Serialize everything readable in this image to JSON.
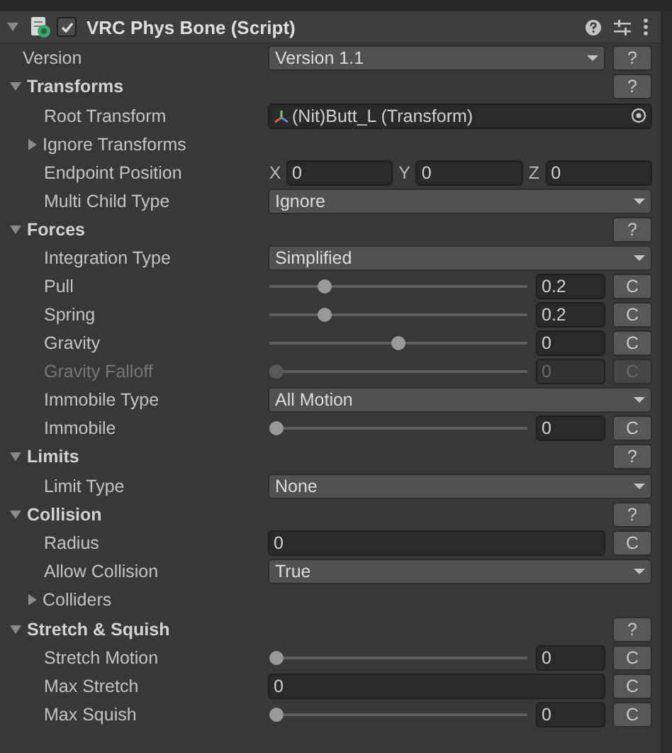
{
  "component": {
    "title": "VRC Phys Bone (Script)",
    "expanded": true,
    "enabled": true
  },
  "rows": [
    {
      "kind": "dropdown",
      "label": "Version",
      "value": "Version 1.1",
      "button": "?"
    },
    {
      "kind": "section",
      "label": "Transforms",
      "expanded": true,
      "button": "?",
      "children": [
        {
          "kind": "object",
          "label": "Root Transform",
          "value": "(Nit)Butt_L (Transform)"
        },
        {
          "kind": "foldout",
          "label": "Ignore Transforms",
          "expanded": false
        },
        {
          "kind": "vector",
          "label": "Endpoint Position",
          "fields": [
            {
              "axis": "X",
              "value": "0"
            },
            {
              "axis": "Y",
              "value": "0"
            },
            {
              "axis": "Z",
              "value": "0"
            }
          ]
        },
        {
          "kind": "dropdown",
          "label": "Multi Child Type",
          "value": "Ignore"
        }
      ]
    },
    {
      "kind": "section",
      "label": "Forces",
      "expanded": true,
      "button": "?",
      "children": [
        {
          "kind": "dropdown",
          "label": "Integration Type",
          "value": "Simplified"
        },
        {
          "kind": "slider",
          "label": "Pull",
          "level": 0.2,
          "value": "0.2",
          "button": "C",
          "disabled": false
        },
        {
          "kind": "slider",
          "label": "Spring",
          "level": 0.2,
          "value": "0.2",
          "button": "C",
          "disabled": false
        },
        {
          "kind": "slider",
          "label": "Gravity",
          "level": 0.5,
          "value": "0",
          "button": "C",
          "disabled": false
        },
        {
          "kind": "slider",
          "label": "Gravity Falloff",
          "level": 0,
          "value": "0",
          "button": "C",
          "disabled": true
        },
        {
          "kind": "dropdown",
          "label": "Immobile Type",
          "value": "All Motion"
        },
        {
          "kind": "slider",
          "label": "Immobile",
          "level": 0,
          "value": "0",
          "button": "C",
          "disabled": false
        }
      ]
    },
    {
      "kind": "section",
      "label": "Limits",
      "expanded": true,
      "button": "?",
      "children": [
        {
          "kind": "dropdown",
          "label": "Limit Type",
          "value": "None"
        }
      ]
    },
    {
      "kind": "section",
      "label": "Collision",
      "expanded": true,
      "button": "?",
      "children": [
        {
          "kind": "number",
          "label": "Radius",
          "value": "0",
          "button": "C"
        },
        {
          "kind": "dropdown",
          "label": "Allow Collision",
          "value": "True"
        },
        {
          "kind": "foldout",
          "label": "Colliders",
          "expanded": false
        }
      ]
    },
    {
      "kind": "section",
      "label": "Stretch & Squish",
      "expanded": true,
      "button": "?",
      "children": [
        {
          "kind": "slider",
          "label": "Stretch Motion",
          "level": 0,
          "value": "0",
          "button": "C",
          "disabled": false
        },
        {
          "kind": "number",
          "label": "Max Stretch",
          "value": "0",
          "button": "C"
        },
        {
          "kind": "slider",
          "label": "Max Squish",
          "level": 0,
          "value": "0",
          "button": "C",
          "disabled": false
        }
      ]
    }
  ]
}
